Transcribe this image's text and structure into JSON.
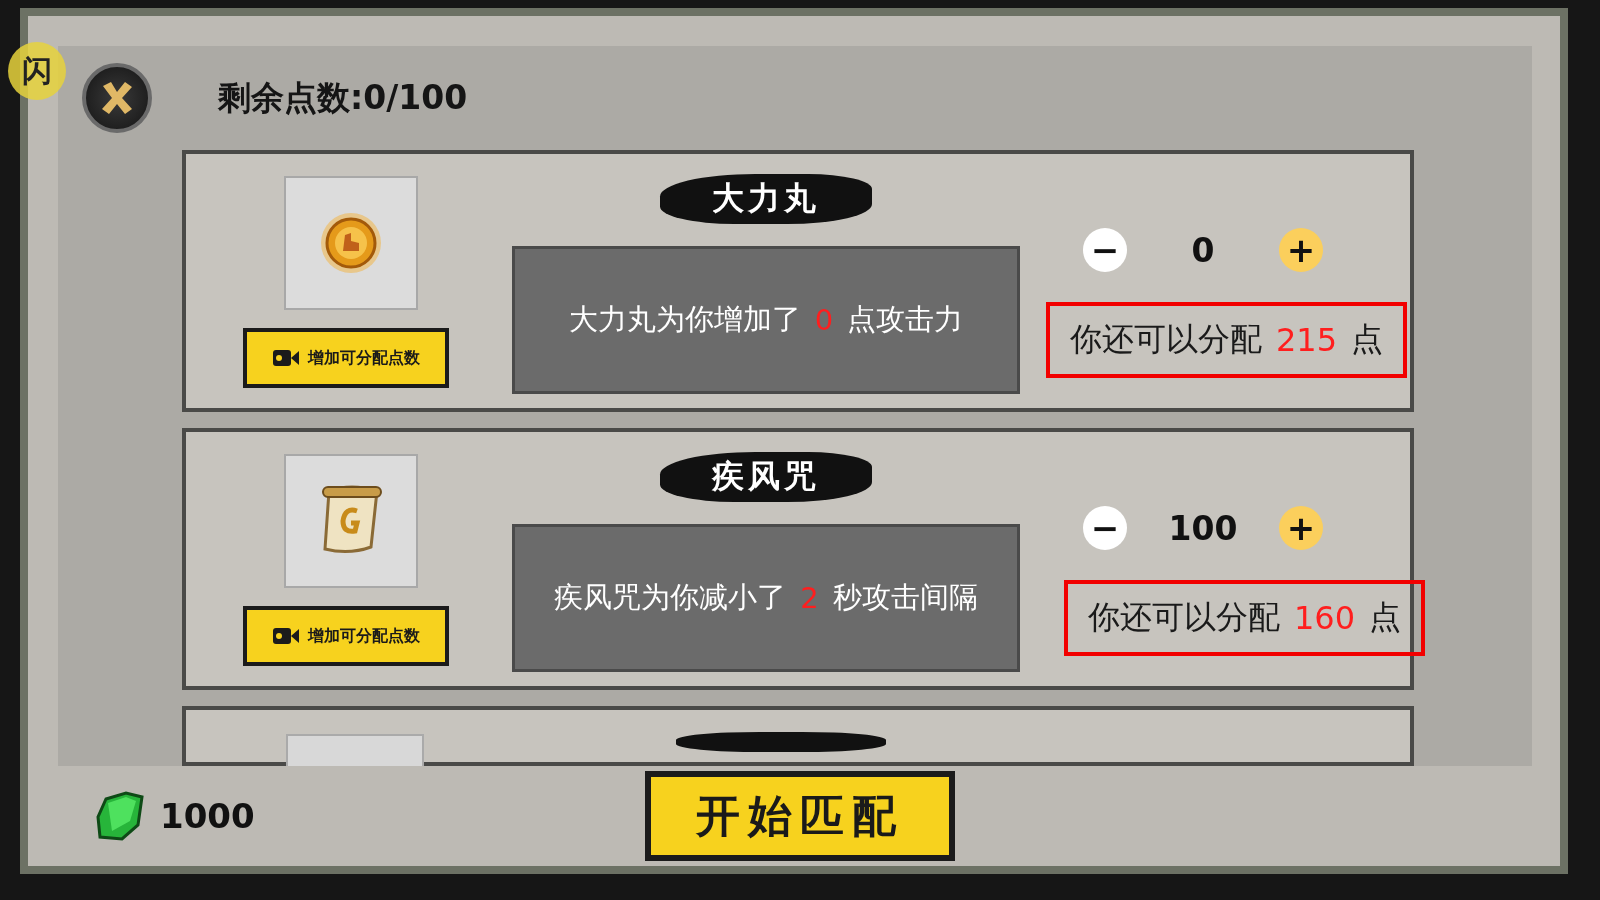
{
  "floating_button": {
    "label": "闪"
  },
  "header": {
    "remaining_points": "剩余点数:0/100"
  },
  "cards": [
    {
      "kind": "coin",
      "title": "大力丸",
      "ad_button": "增加可分配点数",
      "description": {
        "before": "大力丸为你增加了",
        "value": "0",
        "after": "点攻击力"
      },
      "minus": "−",
      "count": "0",
      "plus": "+",
      "remaining": {
        "before": "你还可以分配",
        "value": "215",
        "after": "点"
      }
    },
    {
      "kind": "scroll",
      "title": "疾风咒",
      "ad_button": "增加可分配点数",
      "description": {
        "before": "疾风咒为你减小了",
        "value": "2",
        "after": "秒攻击间隔"
      },
      "minus": "−",
      "count": "100",
      "plus": "+",
      "remaining": {
        "before": "你还可以分配",
        "value": "160",
        "after": "点"
      }
    }
  ],
  "footer": {
    "gems": "1000",
    "start_button": "开始匹配"
  }
}
